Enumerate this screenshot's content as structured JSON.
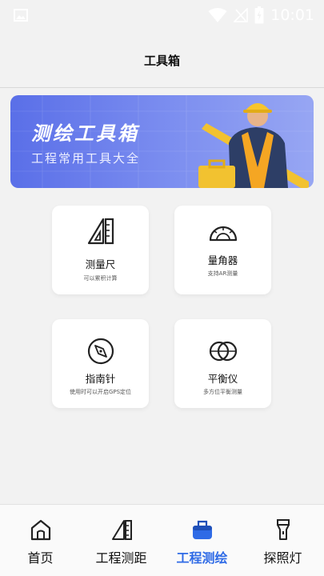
{
  "status_bar": {
    "time": "10:01"
  },
  "header": {
    "title": "工具箱"
  },
  "banner": {
    "title": "测绘工具箱",
    "subtitle": "工程常用工具大全"
  },
  "tools": [
    {
      "name": "测量尺",
      "desc": "可以累积计算"
    },
    {
      "name": "量角器",
      "desc": "支持AR测量"
    },
    {
      "name": "指南针",
      "desc": "使用时可以开启GPS定位"
    },
    {
      "name": "平衡仪",
      "desc": "多方位平衡测量"
    }
  ],
  "tab_bar": {
    "active_index": 2,
    "accent_color": "#2f6be6",
    "tabs": [
      {
        "label": "首页",
        "icon": "home-icon"
      },
      {
        "label": "工程测距",
        "icon": "ruler-icon"
      },
      {
        "label": "工程测绘",
        "icon": "toolbox-icon"
      },
      {
        "label": "探照灯",
        "icon": "flashlight-icon"
      }
    ]
  }
}
